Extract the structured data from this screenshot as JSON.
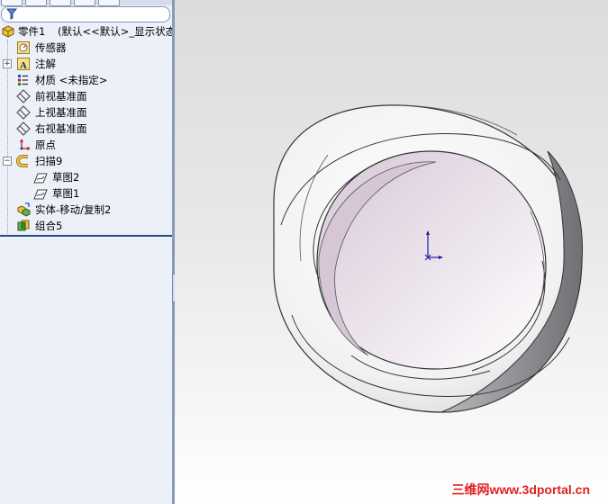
{
  "feature_tree": {
    "filter_icon": "filter-icon",
    "root": {
      "name": "零件1",
      "config": "(默认<<默认>_显示状态"
    },
    "items": [
      {
        "label": "传感器",
        "icon": "sensor-icon"
      },
      {
        "label": "注解",
        "icon": "annotation-icon"
      },
      {
        "label": "材质 <未指定>",
        "icon": "material-icon"
      },
      {
        "label": "前视基准面",
        "icon": "plane-icon"
      },
      {
        "label": "上视基准面",
        "icon": "plane-icon"
      },
      {
        "label": "右视基准面",
        "icon": "plane-icon"
      },
      {
        "label": "原点",
        "icon": "origin-icon"
      },
      {
        "label": "扫描9",
        "icon": "sweep-icon",
        "children": [
          {
            "label": "草图2",
            "icon": "sketch-icon"
          },
          {
            "label": "草图1",
            "icon": "sketch-icon"
          }
        ]
      },
      {
        "label": "实体-移动/复制2",
        "icon": "move-copy-icon"
      },
      {
        "label": "组合5",
        "icon": "combine-icon"
      }
    ]
  },
  "graphics_area": {
    "model": "twisted-ring-solid",
    "triad": "origin-triad-icon",
    "watermark": "三维网www.3dportal.cn"
  },
  "colors": {
    "watermark": "#e02020",
    "tree_accent": "#2b4a86",
    "origin_triad": "#1a1aa0"
  }
}
